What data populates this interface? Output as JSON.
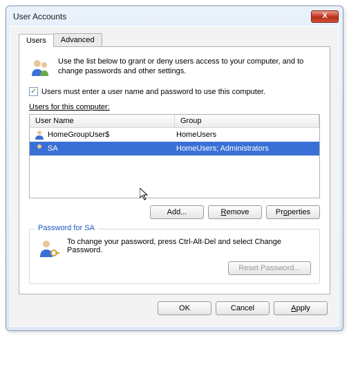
{
  "window": {
    "title": "User Accounts"
  },
  "tabs": {
    "users": "Users",
    "advanced": "Advanced"
  },
  "intro": "Use the list below to grant or deny users access to your computer, and to change passwords and other settings.",
  "checkbox": {
    "label": "Users must enter a user name and password to use this computer.",
    "checked": true
  },
  "listLabel": "Users for this computer:",
  "columns": {
    "name": "User Name",
    "group": "Group"
  },
  "rows": [
    {
      "name": "HomeGroupUser$",
      "group": "HomeUsers",
      "selected": false
    },
    {
      "name": "SA",
      "group": "HomeUsers; Administrators",
      "selected": true
    }
  ],
  "buttons": {
    "add": "Add...",
    "remove": "Remove",
    "properties": "Properties",
    "reset": "Reset Password...",
    "ok": "OK",
    "cancel": "Cancel",
    "apply": "Apply"
  },
  "group": {
    "legend": "Password for SA",
    "text": "To change your password, press Ctrl-Alt-Del and select Change Password."
  }
}
